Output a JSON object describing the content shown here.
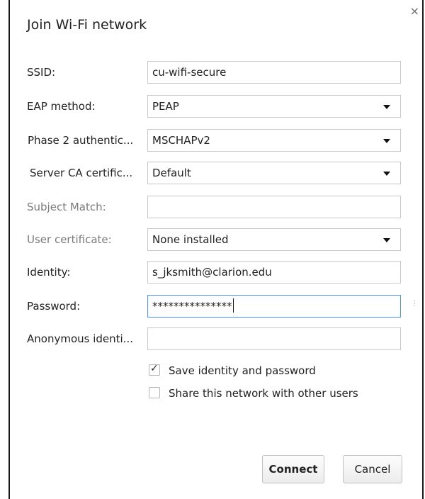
{
  "dialog": {
    "title": "Join Wi-Fi network",
    "close_glyph": "×"
  },
  "fields": {
    "ssid": {
      "label": "SSID:",
      "value": "cu-wifi-secure"
    },
    "eap_method": {
      "label": "EAP method:",
      "value": "PEAP"
    },
    "phase2": {
      "label": "Phase 2 authentic...",
      "value": "MSCHAPv2"
    },
    "server_ca": {
      "label": "Server CA certific...",
      "value": "Default"
    },
    "subject_match": {
      "label": "Subject Match:",
      "value": ""
    },
    "user_cert": {
      "label": "User certificate:",
      "value": "None installed"
    },
    "identity": {
      "label": "Identity:",
      "value": "s_jksmith@clarion.edu"
    },
    "password": {
      "label": "Password:",
      "value": "***************"
    },
    "anonymous_identity": {
      "label": "Anonymous identi...",
      "value": ""
    }
  },
  "checkboxes": {
    "save_identity": {
      "label": "Save identity and password",
      "checked": true,
      "tick_glyph": "✓"
    },
    "share_network": {
      "label": "Share this network with other users",
      "checked": false
    }
  },
  "buttons": {
    "connect": "Connect",
    "cancel": "Cancel"
  },
  "icons": {
    "close": "close-icon",
    "dropdown": "chevron-down-icon",
    "show_password": "eye-icon",
    "checkmark": "checkmark-icon"
  },
  "colors": {
    "focus_border": "#4d90fe",
    "disabled_label": "#7a7a7a"
  }
}
